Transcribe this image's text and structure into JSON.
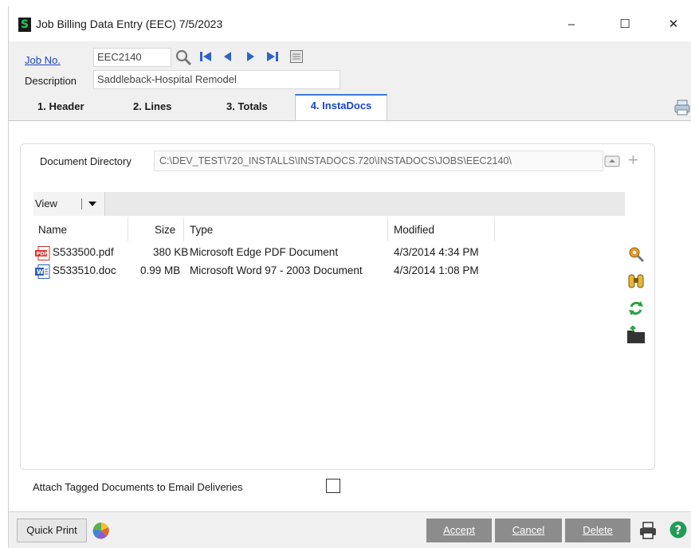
{
  "window": {
    "title": "Job Billing Data Entry (EEC) 7/5/2023",
    "app_icon_letter": "S",
    "minimize_glyph": "–",
    "maximize_glyph": "☐",
    "close_glyph": "✕"
  },
  "job": {
    "job_no_label": "Job No.",
    "job_no_value": "EEC2140",
    "description_label": "Description",
    "description_value": "Saddleback-Hospital Remodel"
  },
  "tabs": [
    {
      "label": "1. Header"
    },
    {
      "label": "2. Lines"
    },
    {
      "label": "3. Totals"
    },
    {
      "label": "4. InstaDocs",
      "active": true
    }
  ],
  "instadocs": {
    "directory_label": "Document Directory",
    "directory_value": "C:\\DEV_TEST\\720_INSTALLS\\INSTADOCS.720\\INSTADOCS\\JOBS\\EEC2140\\",
    "view_label": "View",
    "columns": [
      "Name",
      "Size",
      "Type",
      "Modified"
    ],
    "files": [
      {
        "name": "S533500.pdf",
        "size": "380 KB",
        "type": "Microsoft Edge PDF Document",
        "modified": "4/3/2014 4:34 PM",
        "icon": "pdf-file-icon"
      },
      {
        "name": "S533510.doc",
        "size": "0.99 MB",
        "type": "Microsoft Word 97 - 2003 Document",
        "modified": "4/3/2014 1:08 PM",
        "icon": "word-file-icon"
      }
    ],
    "attach_label": "Attach Tagged Documents to Email Deliveries",
    "attach_checked": false
  },
  "footer": {
    "quick_print": "Quick Print",
    "accept": "Accept",
    "cancel": "Cancel",
    "delete": "Delete"
  },
  "colors": {
    "link_blue": "#1a44c8",
    "button_gray": "#8c8c8c",
    "tab_accent": "#3a7bd5"
  }
}
